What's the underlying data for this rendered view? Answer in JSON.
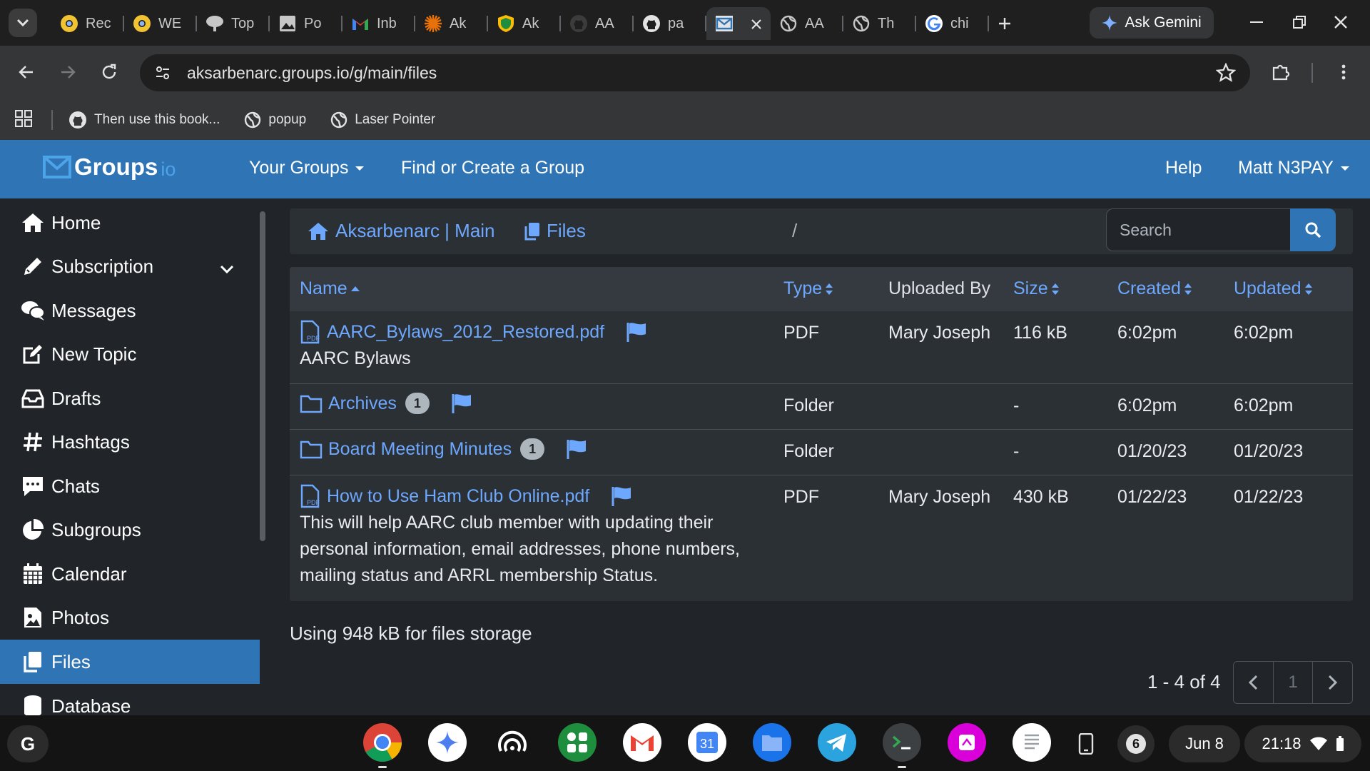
{
  "browser": {
    "tabs": [
      {
        "label": "Rec",
        "icon": "chrome-canary-icon"
      },
      {
        "label": "WE",
        "icon": "chrome-canary-icon"
      },
      {
        "label": "Top",
        "icon": "tree-icon"
      },
      {
        "label": "Po",
        "icon": "image-icon"
      },
      {
        "label": "Inb",
        "icon": "gmail-icon"
      },
      {
        "label": "Ak",
        "icon": "sunburst-icon"
      },
      {
        "label": "Ak",
        "icon": "shield-icon"
      },
      {
        "label": "AA",
        "icon": "github-dark-icon"
      },
      {
        "label": "pa",
        "icon": "github-icon"
      },
      {
        "label": "",
        "icon": "groupsio-icon",
        "active": true
      },
      {
        "label": "AA",
        "icon": "globe-icon"
      },
      {
        "label": "Th",
        "icon": "globe-icon"
      },
      {
        "label": "chi",
        "icon": "google-icon"
      }
    ],
    "gemini_label": "Ask Gemini",
    "url": "aksarbenarc.groups.io/g/main/files",
    "bookmarks": [
      {
        "label": "Then use this book...",
        "icon": "github-icon"
      },
      {
        "label": "popup",
        "icon": "globe-icon"
      },
      {
        "label": "Laser Pointer",
        "icon": "globe-icon"
      }
    ]
  },
  "site": {
    "logo_text": "Groups",
    "logo_suffix": "io",
    "nav": {
      "your_groups": "Your Groups",
      "find_create": "Find or Create a Group",
      "help": "Help",
      "user": "Matt N3PAY"
    },
    "sidebar": [
      {
        "label": "Home",
        "icon": "home-icon"
      },
      {
        "label": "Subscription",
        "icon": "pencil-icon"
      },
      {
        "label": "Messages",
        "icon": "messages-icon"
      },
      {
        "label": "New Topic",
        "icon": "edit-icon"
      },
      {
        "label": "Drafts",
        "icon": "inbox-icon"
      },
      {
        "label": "Hashtags",
        "icon": "hashtag-icon"
      },
      {
        "label": "Chats",
        "icon": "chat-icon"
      },
      {
        "label": "Subgroups",
        "icon": "pie-icon"
      },
      {
        "label": "Calendar",
        "icon": "calendar-icon"
      },
      {
        "label": "Photos",
        "icon": "photo-icon"
      },
      {
        "label": "Files",
        "icon": "files-icon",
        "active": true
      },
      {
        "label": "Database",
        "icon": "database-icon"
      }
    ],
    "breadcrumb": {
      "group": "Aksarbenarc | Main",
      "separator": "/",
      "current": "Files"
    },
    "search_placeholder": "Search",
    "table": {
      "headers": {
        "name": "Name",
        "type": "Type",
        "uploaded_by": "Uploaded By",
        "size": "Size",
        "created": "Created",
        "updated": "Updated"
      },
      "rows": [
        {
          "name": "AARC_Bylaws_2012_Restored.pdf",
          "kind": "pdf",
          "description": "AARC Bylaws",
          "type": "PDF",
          "uploaded_by": "Mary Joseph",
          "size": "116 kB",
          "created": "6:02pm",
          "updated": "6:02pm"
        },
        {
          "name": "Archives",
          "kind": "folder",
          "count": "1",
          "type": "Folder",
          "uploaded_by": "",
          "size": "-",
          "created": "6:02pm",
          "updated": "6:02pm"
        },
        {
          "name": "Board Meeting Minutes",
          "kind": "folder",
          "count": "1",
          "type": "Folder",
          "uploaded_by": "",
          "size": "-",
          "created": "01/20/23",
          "updated": "01/20/23"
        },
        {
          "name": "How to Use Ham Club Online.pdf",
          "kind": "pdf",
          "description_lines": [
            "This will help AARC club member with updating their",
            "personal information, email addresses, phone numbers,",
            "mailing status and ARRL membership Status."
          ],
          "type": "PDF",
          "uploaded_by": "Mary Joseph",
          "size": "430 kB",
          "created": "01/22/23",
          "updated": "01/22/23"
        }
      ]
    },
    "storage_text": "Using 948 kB for files storage",
    "pagination": {
      "info": "1 - 4 of 4",
      "page": "1"
    }
  },
  "shelf": {
    "launcher": "G",
    "apps": [
      "chrome-icon",
      "gemini-icon",
      "podcast-icon",
      "apps-icon",
      "gmail-icon",
      "calendar-icon",
      "files-icon",
      "telegram-icon",
      "terminal-icon",
      "canvas-icon",
      "notes-icon"
    ],
    "calendar_day": "31",
    "notifications": "6",
    "date": "Jun 8",
    "time": "21:18"
  },
  "colors": {
    "brand": "#2f74b5",
    "link": "#6ea8fe",
    "page_bg": "#212529"
  }
}
